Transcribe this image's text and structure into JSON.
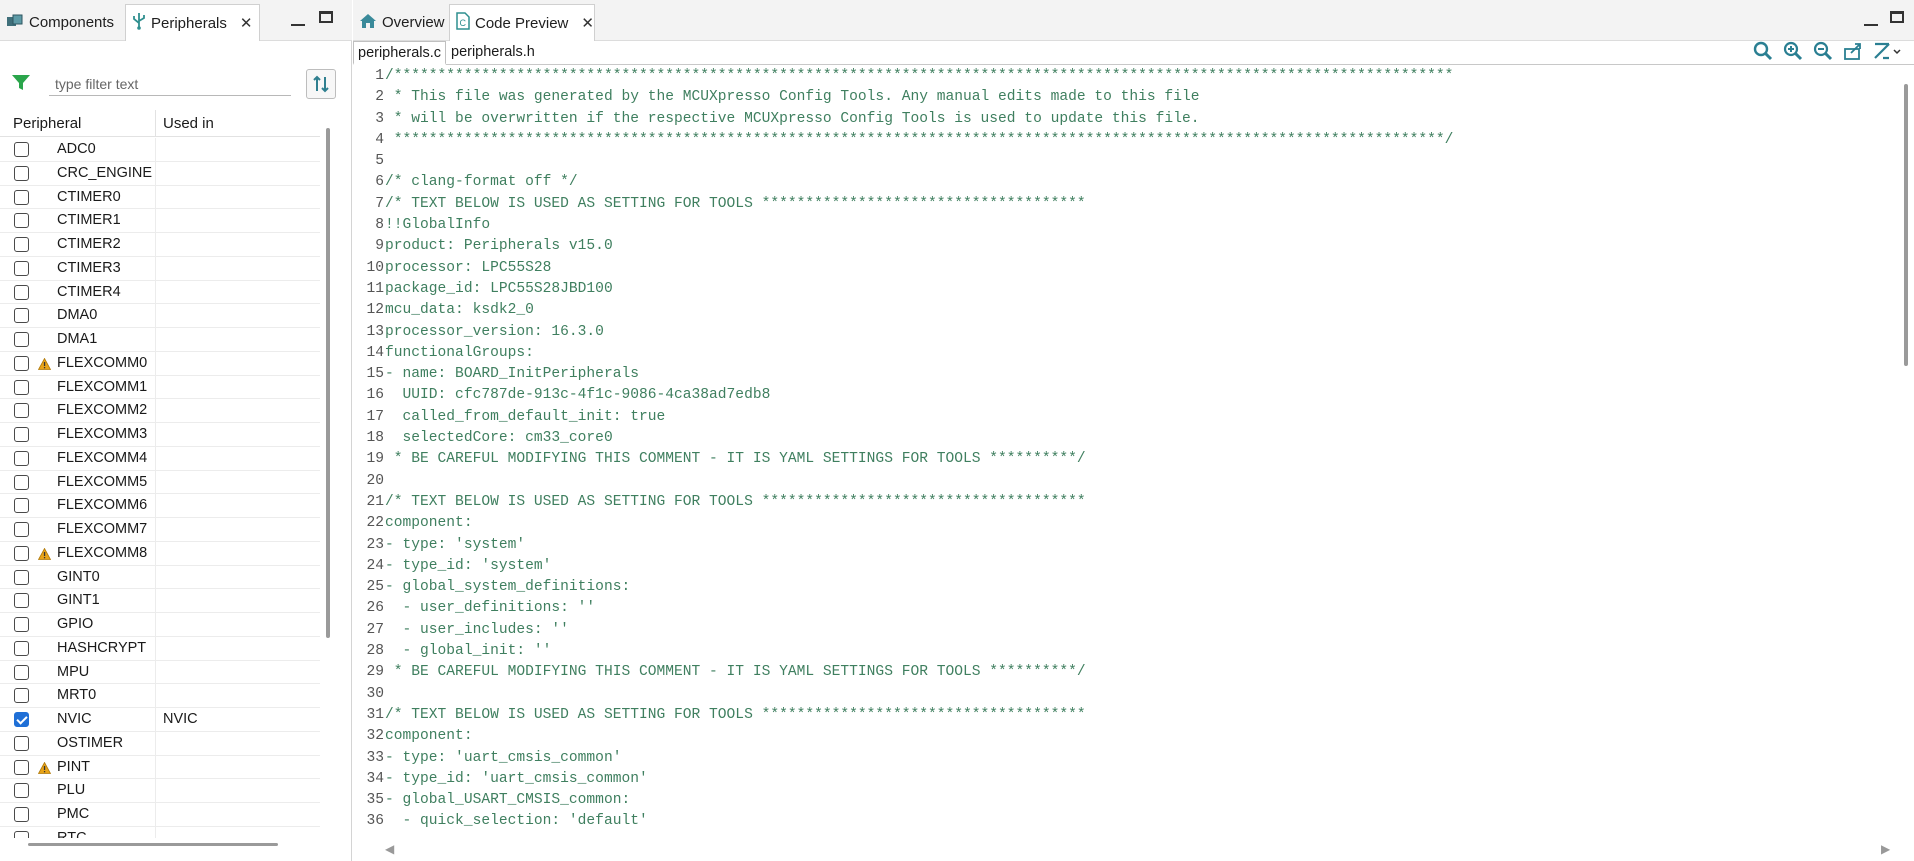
{
  "left_panel": {
    "tabs": [
      {
        "label": "Components",
        "icon": "components-icon",
        "active": false
      },
      {
        "label": "Peripherals",
        "icon": "peripherals-usb-icon",
        "active": true,
        "closable": true
      }
    ],
    "filter": {
      "placeholder": "type filter text",
      "value": ""
    },
    "columns": {
      "peripheral": "Peripheral",
      "used_in": "Used in"
    },
    "rows": [
      {
        "name": "ADC0",
        "checked": false,
        "warning": false,
        "used_in": ""
      },
      {
        "name": "CRC_ENGINE",
        "checked": false,
        "warning": false,
        "used_in": ""
      },
      {
        "name": "CTIMER0",
        "checked": false,
        "warning": false,
        "used_in": ""
      },
      {
        "name": "CTIMER1",
        "checked": false,
        "warning": false,
        "used_in": ""
      },
      {
        "name": "CTIMER2",
        "checked": false,
        "warning": false,
        "used_in": ""
      },
      {
        "name": "CTIMER3",
        "checked": false,
        "warning": false,
        "used_in": ""
      },
      {
        "name": "CTIMER4",
        "checked": false,
        "warning": false,
        "used_in": ""
      },
      {
        "name": "DMA0",
        "checked": false,
        "warning": false,
        "used_in": ""
      },
      {
        "name": "DMA1",
        "checked": false,
        "warning": false,
        "used_in": ""
      },
      {
        "name": "FLEXCOMM0",
        "checked": false,
        "warning": true,
        "used_in": ""
      },
      {
        "name": "FLEXCOMM1",
        "checked": false,
        "warning": false,
        "used_in": ""
      },
      {
        "name": "FLEXCOMM2",
        "checked": false,
        "warning": false,
        "used_in": ""
      },
      {
        "name": "FLEXCOMM3",
        "checked": false,
        "warning": false,
        "used_in": ""
      },
      {
        "name": "FLEXCOMM4",
        "checked": false,
        "warning": false,
        "used_in": ""
      },
      {
        "name": "FLEXCOMM5",
        "checked": false,
        "warning": false,
        "used_in": ""
      },
      {
        "name": "FLEXCOMM6",
        "checked": false,
        "warning": false,
        "used_in": ""
      },
      {
        "name": "FLEXCOMM7",
        "checked": false,
        "warning": false,
        "used_in": ""
      },
      {
        "name": "FLEXCOMM8",
        "checked": false,
        "warning": true,
        "used_in": ""
      },
      {
        "name": "GINT0",
        "checked": false,
        "warning": false,
        "used_in": ""
      },
      {
        "name": "GINT1",
        "checked": false,
        "warning": false,
        "used_in": ""
      },
      {
        "name": "GPIO",
        "checked": false,
        "warning": false,
        "used_in": ""
      },
      {
        "name": "HASHCRYPT",
        "checked": false,
        "warning": false,
        "used_in": ""
      },
      {
        "name": "MPU",
        "checked": false,
        "warning": false,
        "used_in": ""
      },
      {
        "name": "MRT0",
        "checked": false,
        "warning": false,
        "used_in": ""
      },
      {
        "name": "NVIC",
        "checked": true,
        "warning": false,
        "used_in": "NVIC"
      },
      {
        "name": "OSTIMER",
        "checked": false,
        "warning": false,
        "used_in": ""
      },
      {
        "name": "PINT",
        "checked": false,
        "warning": true,
        "used_in": ""
      },
      {
        "name": "PLU",
        "checked": false,
        "warning": false,
        "used_in": ""
      },
      {
        "name": "PMC",
        "checked": false,
        "warning": false,
        "used_in": ""
      },
      {
        "name": "RTC",
        "checked": false,
        "warning": false,
        "used_in": ""
      }
    ]
  },
  "right_panel": {
    "tabs": [
      {
        "label": "Overview",
        "icon": "home-icon",
        "active": false
      },
      {
        "label": "Code Preview",
        "icon": "code-file-icon",
        "active": true,
        "closable": true
      }
    ],
    "file_tabs": [
      {
        "label": "peripherals.c",
        "active": true
      },
      {
        "label": "peripherals.h",
        "active": false
      }
    ],
    "toolbar": [
      "search-icon",
      "zoom-in-icon",
      "zoom-out-icon",
      "export-icon",
      "settings-dropdown-icon"
    ],
    "code_lines": [
      "/*************************************************************************************************************************",
      " * This file was generated by the MCUXpresso Config Tools. Any manual edits made to this file",
      " * will be overwritten if the respective MCUXpresso Config Tools is used to update this file.",
      " ************************************************************************************************************************/",
      "",
      "/* clang-format off */",
      "/* TEXT BELOW IS USED AS SETTING FOR TOOLS *************************************",
      "!!GlobalInfo",
      "product: Peripherals v15.0",
      "processor: LPC55S28",
      "package_id: LPC55S28JBD100",
      "mcu_data: ksdk2_0",
      "processor_version: 16.3.0",
      "functionalGroups:",
      "- name: BOARD_InitPeripherals",
      "  UUID: cfc787de-913c-4f1c-9086-4ca38ad7edb8",
      "  called_from_default_init: true",
      "  selectedCore: cm33_core0",
      " * BE CAREFUL MODIFYING THIS COMMENT - IT IS YAML SETTINGS FOR TOOLS **********/",
      "",
      "/* TEXT BELOW IS USED AS SETTING FOR TOOLS *************************************",
      "component:",
      "- type: 'system'",
      "- type_id: 'system'",
      "- global_system_definitions:",
      "  - user_definitions: ''",
      "  - user_includes: ''",
      "  - global_init: ''",
      " * BE CAREFUL MODIFYING THIS COMMENT - IT IS YAML SETTINGS FOR TOOLS **********/",
      "",
      "/* TEXT BELOW IS USED AS SETTING FOR TOOLS *************************************",
      "component:",
      "- type: 'uart_cmsis_common'",
      "- type_id: 'uart_cmsis_common'",
      "- global_USART_CMSIS_common:",
      "  - quick_selection: 'default'"
    ],
    "fold_lines": [
      15,
      19,
      23,
      24,
      25,
      29,
      33,
      34,
      35
    ]
  },
  "colors": {
    "code_comment": "#3f7f5f",
    "accent": "#1f6fd6",
    "warning": "#e8a317",
    "filter_icon": "#2aa54b"
  }
}
